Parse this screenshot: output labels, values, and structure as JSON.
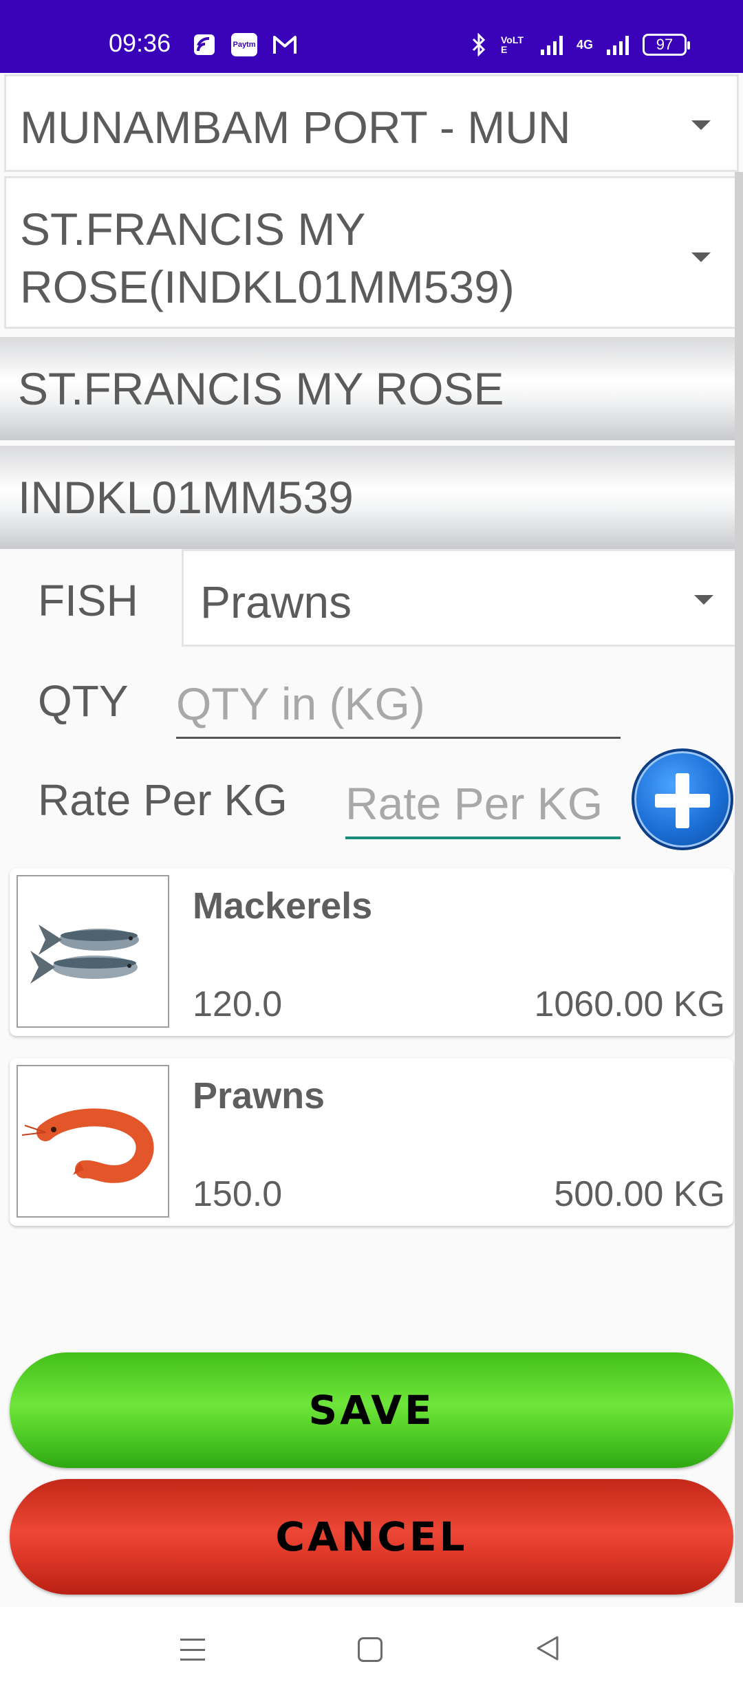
{
  "status_bar": {
    "time": "09:36",
    "paytm_label": "Paytm",
    "volte_label": "VoLTE",
    "network_label": "4G",
    "battery": "97",
    "icons": [
      "cast-icon",
      "paytm-icon",
      "gmail-icon",
      "bluetooth-icon",
      "volte-icon",
      "signal-icon",
      "signal-4g-icon",
      "battery-icon"
    ]
  },
  "port": {
    "selected": "MUNAMBAM PORT - MUN"
  },
  "boat": {
    "selected": "ST.FRANCIS MY ROSE(INDKL01MM539)",
    "name": "ST.FRANCIS MY ROSE",
    "registration": "INDKL01MM539"
  },
  "form": {
    "fish_label": "FISH",
    "fish_selected": "Prawns",
    "qty_label": "QTY",
    "qty_value": "",
    "qty_placeholder": "QTY in (KG)",
    "rate_label": "Rate Per KG",
    "rate_value": "",
    "rate_placeholder": "Rate Per KG"
  },
  "items": [
    {
      "name": "Mackerels",
      "rate": "120.0",
      "quantity": "1060.00 KG"
    },
    {
      "name": "Prawns",
      "rate": "150.0",
      "quantity": "500.00 KG"
    }
  ],
  "actions": {
    "save_label": "SAVE",
    "cancel_label": "CANCEL",
    "save_color": "#5bd62c",
    "cancel_color": "#e53d2e"
  },
  "colors": {
    "status_bar": "#3a02b8",
    "accent_underline": "#1a8a7a",
    "add_button": "#1b6fd6"
  }
}
